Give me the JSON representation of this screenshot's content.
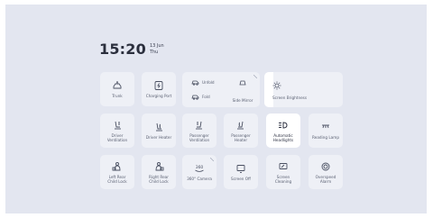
{
  "clock": {
    "time": "15:20",
    "date": "13 Jun",
    "weekday": "Thu"
  },
  "tiles": [
    {
      "label": "Trunk",
      "icon": "trunk-icon"
    },
    {
      "label": "Charging Port",
      "icon": "charging-port-icon"
    },
    {
      "label": "Driver\nVentilation",
      "icon": "driver-ventilation-icon"
    },
    {
      "label": "Driver Heater",
      "icon": "driver-heater-icon"
    },
    {
      "label": "Passenger\nVentilation",
      "icon": "passenger-ventilation-icon"
    },
    {
      "label": "Passenger\nHeater",
      "icon": "passenger-heater-icon"
    },
    {
      "label": "Automatic\nHeadlights",
      "icon": "headlights-icon",
      "active": true
    },
    {
      "label": "Reading Lamp",
      "icon": "reading-lamp-icon"
    },
    {
      "label": "Left Rear\nChild Lock",
      "icon": "left-child-lock-icon"
    },
    {
      "label": "Right Rear\nChild Lock",
      "icon": "right-child-lock-icon"
    },
    {
      "label": "360° Camera",
      "icon": "camera-360-icon"
    },
    {
      "label": "Screen Off",
      "icon": "screen-off-icon"
    },
    {
      "label": "Screen\nCleaning",
      "icon": "screen-cleaning-icon"
    },
    {
      "label": "Overspeed\nAlarm",
      "icon": "overspeed-alarm-icon"
    }
  ],
  "mirrors": {
    "unfold": "Unfold",
    "fold": "Fold",
    "adjust": "Side Mirror\nAdjustment"
  },
  "brightness": {
    "label": "Screen Brightness",
    "level": 0.12
  },
  "colors": {
    "background": "#e3e6f0",
    "tile": "#eef0f6",
    "active_tile": "#ffffff",
    "icon": "#4a5062"
  }
}
